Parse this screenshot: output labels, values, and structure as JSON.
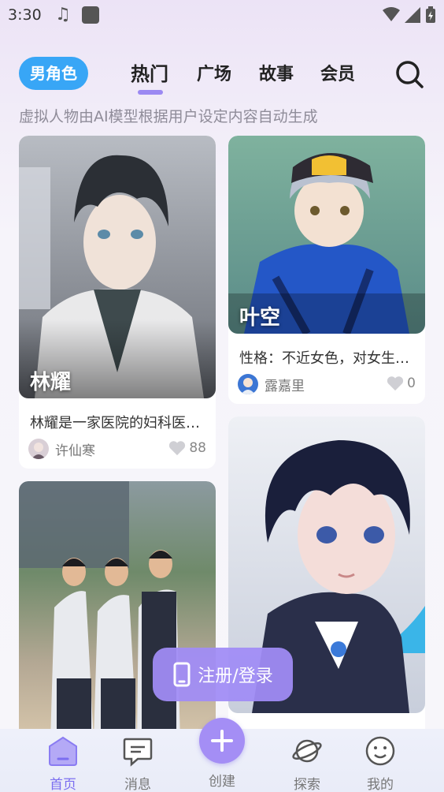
{
  "status_bar": {
    "time": "3:30"
  },
  "header": {
    "role_filter": "男角色",
    "tabs": [
      {
        "label": "热门",
        "active": true
      },
      {
        "label": "广场",
        "active": false
      },
      {
        "label": "故事",
        "active": false
      },
      {
        "label": "会员",
        "active": false
      }
    ]
  },
  "subtitle": "虚拟人物由AI模型根据用户设定内容自动生成",
  "cards": [
    {
      "name": "林耀",
      "description": "林耀是一家医院的妇科医生…",
      "author": "许仙寒",
      "likes": "88"
    },
    {
      "name": "叶空",
      "description": "性格：不近女色，对女生…",
      "author": "露嘉里",
      "likes": "0"
    },
    {
      "name": "",
      "description": "",
      "author": "",
      "likes": ""
    },
    {
      "name": "",
      "description": "",
      "author": "",
      "likes": ""
    }
  ],
  "login_button": {
    "label": "注册/登录"
  },
  "bottom_nav": {
    "items": [
      {
        "label": "首页",
        "active": true
      },
      {
        "label": "消息",
        "active": false
      },
      {
        "label": "创建",
        "active": false
      },
      {
        "label": "探索",
        "active": false
      },
      {
        "label": "我的",
        "active": false
      }
    ]
  },
  "colors": {
    "accent": "#9b89f2",
    "pill": "#38a6f6"
  }
}
